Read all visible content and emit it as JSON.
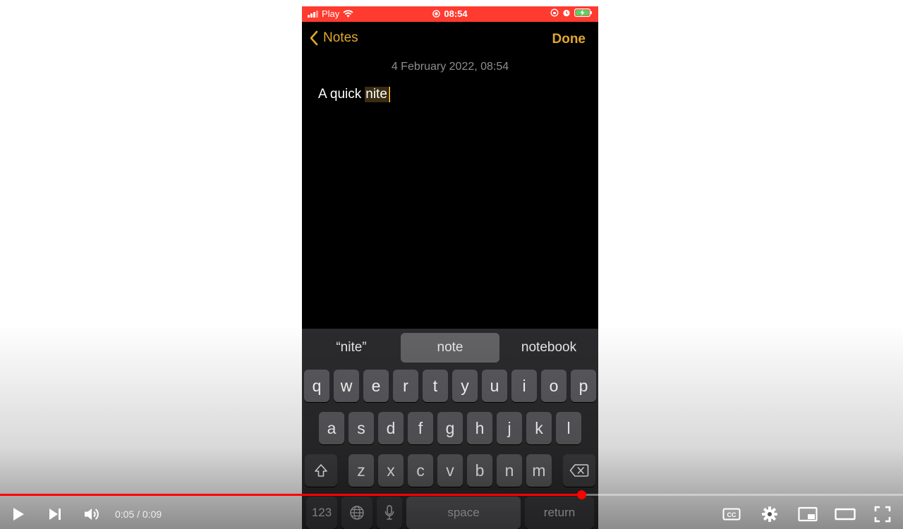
{
  "status_bar": {
    "carrier": "Play",
    "time": "08:54",
    "background": "#ff3b30"
  },
  "nav": {
    "back_label": "Notes",
    "done_label": "Done"
  },
  "note": {
    "date": "4 February 2022, 08:54",
    "text_before": "A quick",
    "text_highlighted": "nite"
  },
  "keyboard": {
    "suggestions": [
      "“nite”",
      "note",
      "notebook"
    ],
    "row1": [
      "q",
      "w",
      "e",
      "r",
      "t",
      "y",
      "u",
      "i",
      "o",
      "p"
    ],
    "row2": [
      "a",
      "s",
      "d",
      "f",
      "g",
      "h",
      "j",
      "k",
      "l"
    ],
    "row3": [
      "z",
      "x",
      "c",
      "v",
      "b",
      "n",
      "m"
    ],
    "numbers_label": "123",
    "space_label": "space",
    "return_label": "return"
  },
  "player": {
    "time_display": "0:05 / 0:09",
    "progress_fraction": 0.644,
    "accent": "#ff0000"
  },
  "colors": {
    "notes_accent": "#e0a82e"
  }
}
